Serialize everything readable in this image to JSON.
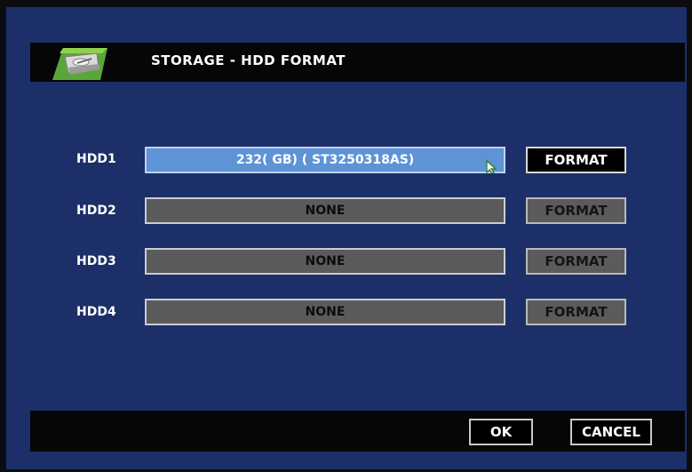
{
  "dialog": {
    "title": "STORAGE - HDD FORMAT",
    "icon": "hdd-icon"
  },
  "hdds": [
    {
      "label": "HDD1",
      "value": "232( GB) ( ST3250318AS)",
      "format_label": "FORMAT",
      "enabled": true
    },
    {
      "label": "HDD2",
      "value": "NONE",
      "format_label": "FORMAT",
      "enabled": false
    },
    {
      "label": "HDD3",
      "value": "NONE",
      "format_label": "FORMAT",
      "enabled": false
    },
    {
      "label": "HDD4",
      "value": "NONE",
      "format_label": "FORMAT",
      "enabled": false
    }
  ],
  "footer": {
    "ok_label": "OK",
    "cancel_label": "CANCEL"
  },
  "colors": {
    "screen_bg": "#1d2f68",
    "bar_bg": "#060606",
    "active_field": "#5e93d6",
    "inactive_field": "#5b5b5b"
  }
}
